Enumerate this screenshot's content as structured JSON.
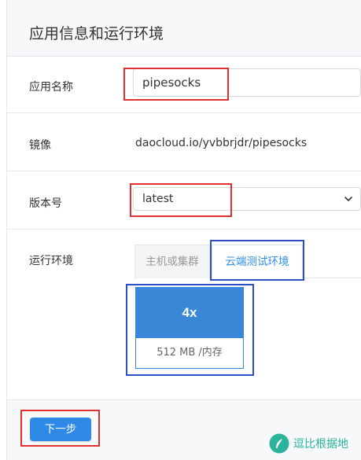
{
  "header": {
    "title": "应用信息和运行环境"
  },
  "app_name": {
    "label": "应用名称",
    "value": "pipesocks"
  },
  "image": {
    "label": "镜像",
    "value": "daocloud.io/yvbbrjdr/pipesocks"
  },
  "version": {
    "label": "版本号",
    "selected": "latest"
  },
  "runtime": {
    "label": "运行环境",
    "tabs": [
      {
        "label": "主机或集群",
        "active": false
      },
      {
        "label": "云端测试环境",
        "active": true
      }
    ],
    "plan": {
      "name": "4x",
      "memory": "512 MB",
      "memory_unit": "/内存"
    }
  },
  "footer": {
    "next_label": "下一步"
  },
  "watermark": {
    "text": "逗比根据地"
  },
  "colors": {
    "accent": "#2e8ae6",
    "highlight_red": "#e03030",
    "highlight_blue": "#2c4fc7",
    "watermark": "#2bb39b"
  },
  "icons": {
    "select": "chevron-down-icon",
    "watermark_logo": "leaf-logo-icon"
  }
}
